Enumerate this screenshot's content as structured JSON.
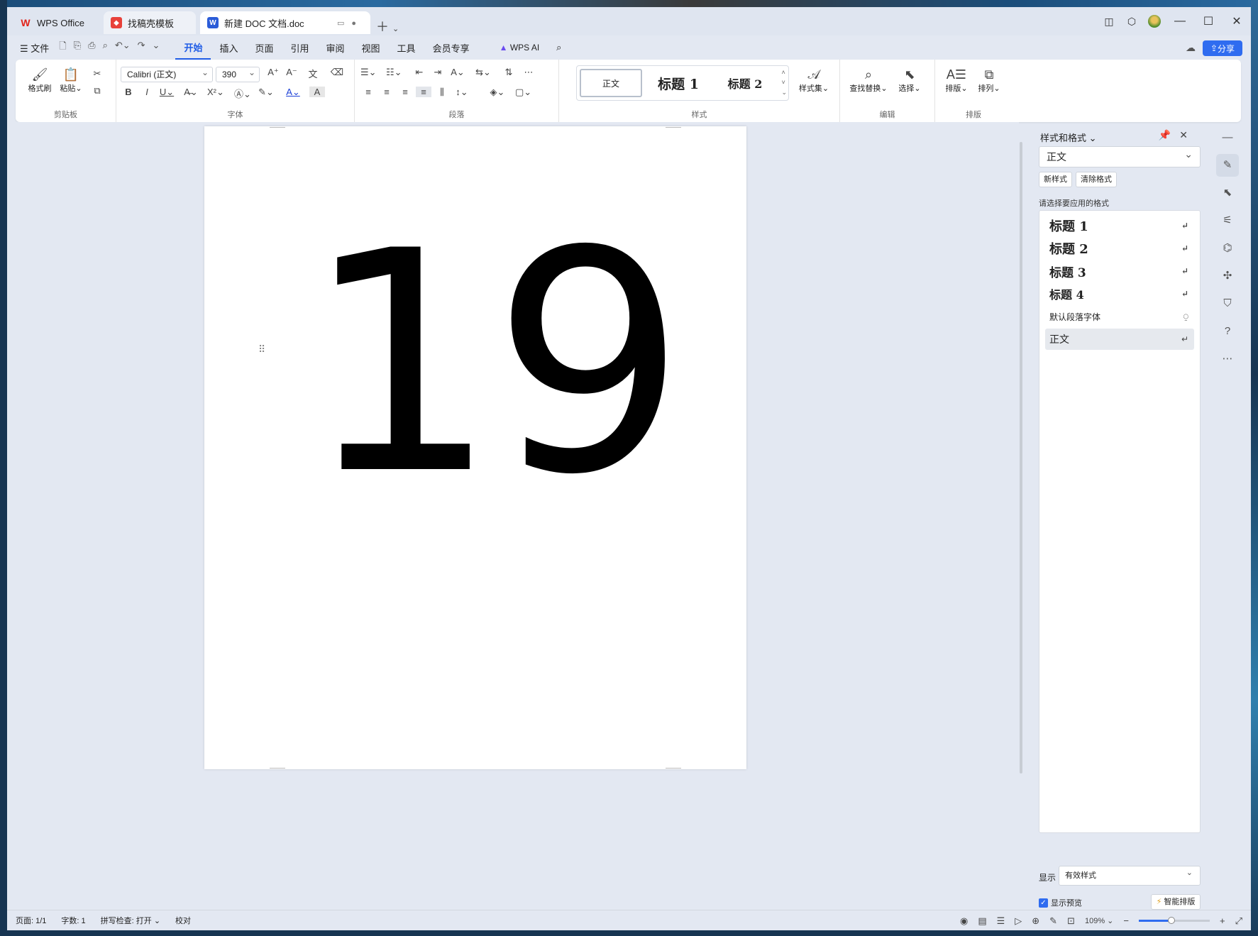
{
  "tabs": {
    "wps": "WPS Office",
    "template": "找稿壳模板",
    "doc": "新建 DOC 文档.doc"
  },
  "menu": {
    "file": "文件",
    "items": [
      "开始",
      "插入",
      "页面",
      "引用",
      "审阅",
      "视图",
      "工具",
      "会员专享"
    ],
    "active": "开始",
    "wps_ai": "WPS AI",
    "share": "分享"
  },
  "ribbon": {
    "clipboard": {
      "label": "剪贴板",
      "format_painter": "格式刷",
      "paste": "粘贴"
    },
    "font": {
      "label": "字体",
      "font_name": "Calibri (正文)",
      "font_size": "390"
    },
    "paragraph": {
      "label": "段落"
    },
    "styles": {
      "label": "样式",
      "normal": "正文",
      "h1": "标题 1",
      "h2": "标题 2",
      "style_set": "样式集"
    },
    "edit": {
      "label": "编辑",
      "find_replace": "查找替换",
      "select": "选择"
    },
    "layout": {
      "label": "排版",
      "typeset": "排版",
      "arrange": "排列"
    }
  },
  "document": {
    "content": "19"
  },
  "panel": {
    "title": "样式和格式",
    "current_style": "正文",
    "new_style": "新样式",
    "clear_format": "清除格式",
    "hint": "请选择要应用的格式",
    "styles": [
      {
        "name": "标题 1",
        "marker": "↵"
      },
      {
        "name": "标题 2",
        "marker": "↵"
      },
      {
        "name": "标题 3",
        "marker": "↵"
      },
      {
        "name": "标题 4",
        "marker": "↵"
      },
      {
        "name": "默认段落字体",
        "marker": "⍜"
      },
      {
        "name": "正文",
        "marker": "↵"
      }
    ],
    "show_label": "显示",
    "show_value": "有效样式",
    "show_preview": "显示预览",
    "smart_layout": "智能排版"
  },
  "status": {
    "page": "页面: 1/1",
    "words": "字数: 1",
    "spell": "拼写检查: 打开",
    "proof": "校对",
    "zoom": "109%",
    "zoom_fraction": 0.46
  },
  "colors": {
    "accent": "#2f6cf0",
    "wps_red": "#e2231a",
    "doc_blue": "#2b5cd8"
  }
}
